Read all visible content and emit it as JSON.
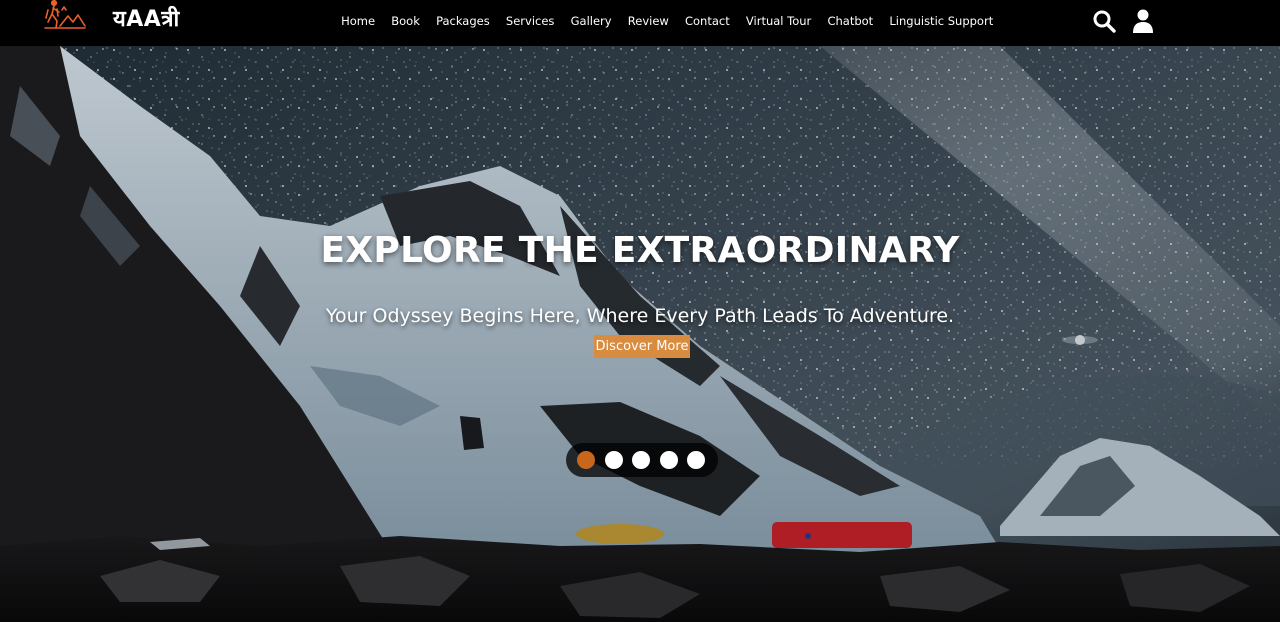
{
  "brand": {
    "name": "यAAत्री"
  },
  "nav": {
    "items": [
      {
        "label": "Home"
      },
      {
        "label": "Book"
      },
      {
        "label": "Packages"
      },
      {
        "label": "Services"
      },
      {
        "label": "Gallery"
      },
      {
        "label": "Review"
      },
      {
        "label": "Contact"
      },
      {
        "label": "Virtual Tour"
      },
      {
        "label": "Chatbot"
      },
      {
        "label": "Linguistic Support"
      }
    ]
  },
  "hero": {
    "title": "EXPLORE THE EXTRAORDINARY",
    "subtitle": "Your Odyssey Begins Here, Where Every Path Leads To Adventure.",
    "cta_label": "Discover More"
  },
  "slider": {
    "total": 5,
    "active_index": 0
  },
  "colors": {
    "accent": "#d98b3f",
    "active_dot": "#c8661c",
    "navbar": "#000000"
  },
  "icons": {
    "logo": "hiker-mountain-icon",
    "search": "search-icon",
    "user": "user-icon"
  }
}
